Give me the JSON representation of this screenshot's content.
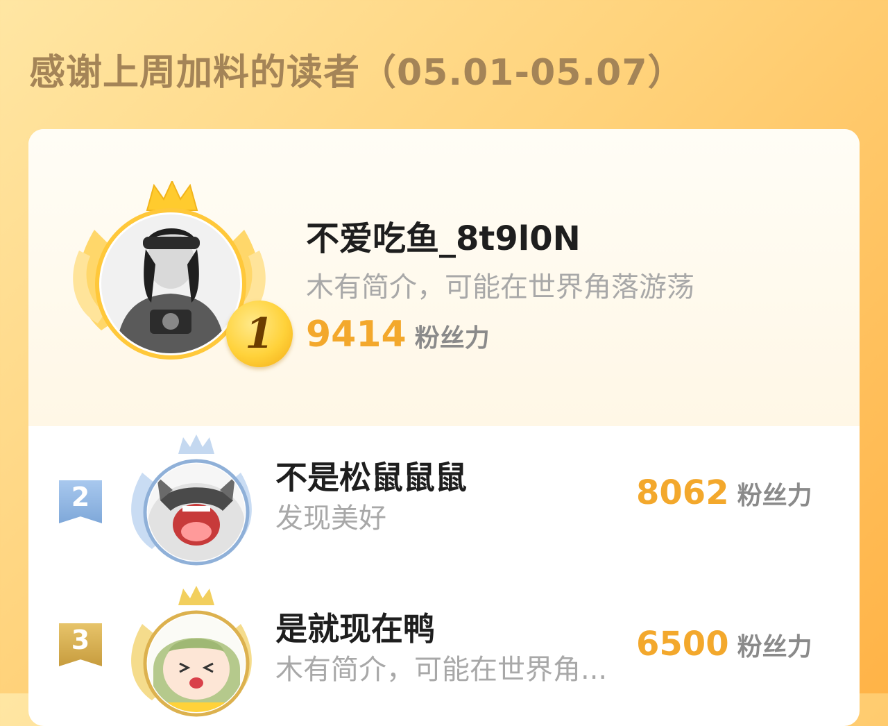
{
  "header": {
    "title": "感谢上周加料的读者（05.01-05.07）"
  },
  "colors": {
    "accent": "#f3a82c",
    "gold": "#ffd23a",
    "silver": "#8fb4e0",
    "bronze": "#d9b35a"
  },
  "leaderboard": [
    {
      "rank": "1",
      "name": "不爱吃鱼_8t9l0N",
      "bio": "木有简介，可能在世界角落游荡",
      "score": "9414",
      "unit": "粉丝力",
      "avatar_icon": "user-avatar-photo"
    },
    {
      "rank": "2",
      "name": "不是松鼠鼠鼠",
      "bio": "发现美好",
      "score": "8062",
      "unit": "粉丝力",
      "avatar_icon": "raccoon-avatar"
    },
    {
      "rank": "3",
      "name": "是就现在鸭",
      "bio": "木有简介，可能在世界角...",
      "score": "6500",
      "unit": "粉丝力",
      "avatar_icon": "anime-girl-avatar"
    }
  ]
}
